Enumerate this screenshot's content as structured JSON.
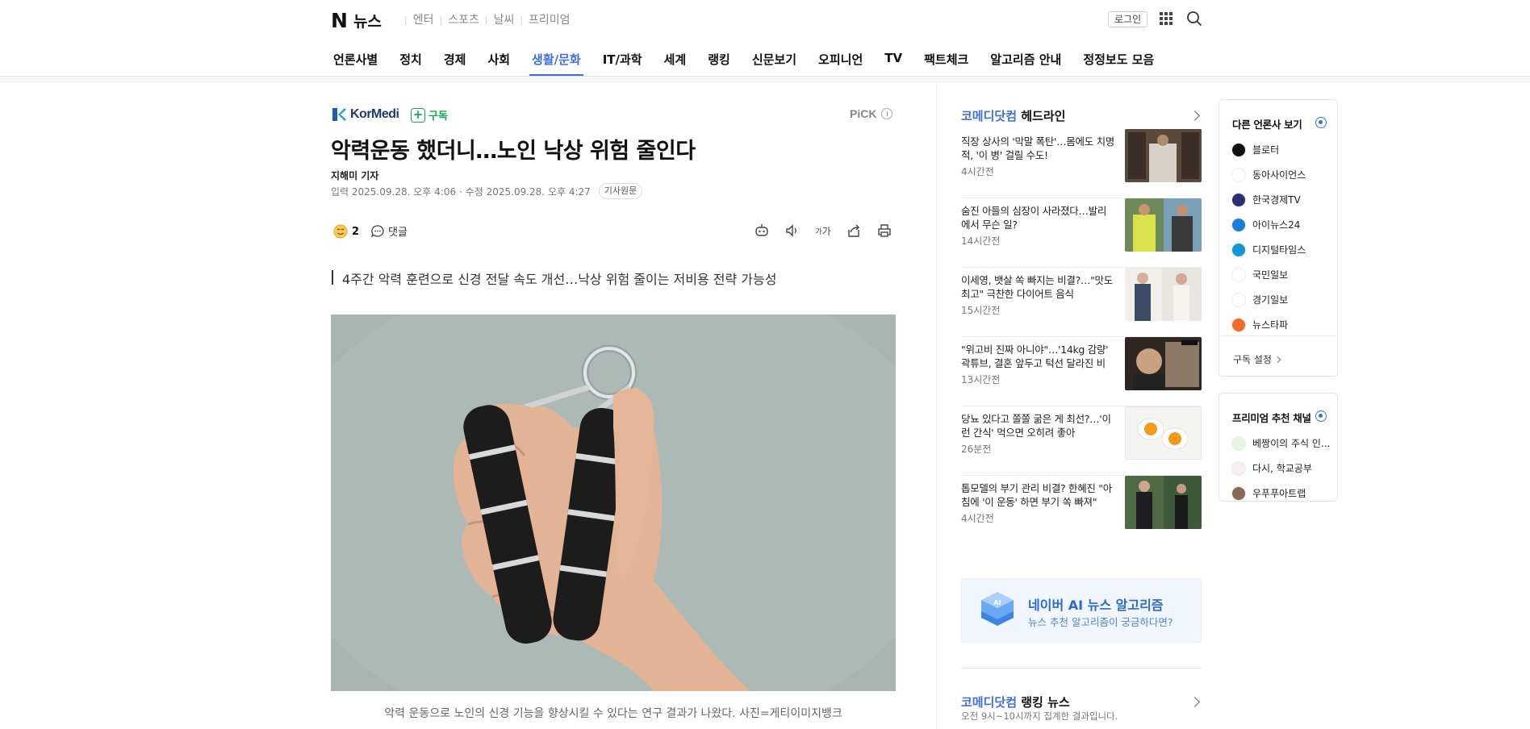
{
  "header": {
    "logo_n": "N",
    "logo_text": "뉴스",
    "services": [
      "엔터",
      "스포츠",
      "날씨",
      "프리미엄"
    ],
    "login_label": "로그인"
  },
  "gnb": [
    {
      "label": "언론사별",
      "active": false
    },
    {
      "label": "정치",
      "active": false
    },
    {
      "label": "경제",
      "active": false
    },
    {
      "label": "사회",
      "active": false
    },
    {
      "label": "생활/문화",
      "active": true
    },
    {
      "label": "IT/과학",
      "active": false
    },
    {
      "label": "세계",
      "active": false
    },
    {
      "label": "랭킹",
      "active": false
    },
    {
      "label": "신문보기",
      "active": false
    },
    {
      "label": "오피니언",
      "active": false
    },
    {
      "label": "TV",
      "active": false
    },
    {
      "label": "팩트체크",
      "active": false
    },
    {
      "label": "알고리즘 안내",
      "active": false
    },
    {
      "label": "정정보도 모음",
      "active": false
    }
  ],
  "article": {
    "press_name": "KorMedi",
    "subscribe_label": "구독",
    "pick_label": "PiCK",
    "title": "악력운동 했더니…노인 낙상 위험 줄인다",
    "reporter": "지해미 기자",
    "input_date": "입력 2025.09.28. 오후 4:06",
    "edit_date": "· 수정 2025.09.28. 오후 4:27",
    "original_label": "기사원문",
    "reaction_count": "2",
    "comment_label": "댓글",
    "tool_fontsize_label": "가",
    "summary": "4주간 악력 훈련으로 신경 전달 속도 개선…낙상 위험 줄이는 저비용 전략 가능성",
    "caption": "악력 운동으로 노인의 신경 기능을 향상시킬 수 있다는 연구 결과가 나왔다. 사진=게티이미지뱅크"
  },
  "headlines": {
    "press": "코메디닷컴",
    "title": "헤드라인",
    "items": [
      {
        "text": "직장 상사의 '막말 폭탄'…몸에도 치명적, '이 병' 걸릴 수도!",
        "time": "4시간전"
      },
      {
        "text": "숨진 아들의 심장이 사라졌다…발리에서 무슨 일?",
        "time": "14시간전"
      },
      {
        "text": "이세영, 뱃살 쏙 빠지는 비결?…\"맛도 최고\" 극찬한 다이어트 음식",
        "time": "15시간전"
      },
      {
        "text": "\"위고비 진짜 아니야\"…'14kg 감량' 곽튜브, 결혼 앞두고 턱선 달라진 비결…",
        "time": "13시간전"
      },
      {
        "text": "당뇨 있다고 쫄쫄 굶은 게 최선?…'이런 간식' 먹으면 오히려 좋아",
        "time": "26분전"
      },
      {
        "text": "톱모델의 부기 관리 비결? 한혜진 \"아침에 '이 운동' 하면 부기 쏙 빠져\"",
        "time": "4시간전"
      }
    ]
  },
  "ai_banner": {
    "title": "네이버 AI 뉴스 알고리즘",
    "subtitle": "뉴스 추천 알고리즘이 궁금하다면?",
    "icon_text": "AI"
  },
  "ranking": {
    "press": "코메디닷컴",
    "title": "랭킹 뉴스",
    "subtitle": "오전 9시~10시까지 집계한 결과입니다."
  },
  "other_press": {
    "title": "다른 언론사 보기",
    "items": [
      {
        "name": "블로터",
        "color": "#111111"
      },
      {
        "name": "동아사이언스",
        "color": "#ffffff"
      },
      {
        "name": "한국경제TV",
        "color": "#2a2f7a"
      },
      {
        "name": "아이뉴스24",
        "color": "#1a7fd8"
      },
      {
        "name": "디지털타임스",
        "color": "#1296d6"
      },
      {
        "name": "국민일보",
        "color": "#ffffff"
      },
      {
        "name": "경기일보",
        "color": "#ffffff"
      },
      {
        "name": "뉴스타파",
        "color": "#f06a2a"
      }
    ],
    "setting_label": "구독 설정"
  },
  "premium": {
    "title": "프리미엄 추천 채널",
    "items": [
      {
        "name": "베짱이의 주식 인...",
        "color": "#e8f5e1"
      },
      {
        "name": "다시, 학교공부",
        "color": "#fbeeee"
      },
      {
        "name": "우푸푸아트랩",
        "color": "#8a6a54"
      }
    ]
  },
  "colors": {
    "accent": "#3f6fdd",
    "subscribe": "#12a84b",
    "ai": "#2b68d8"
  }
}
